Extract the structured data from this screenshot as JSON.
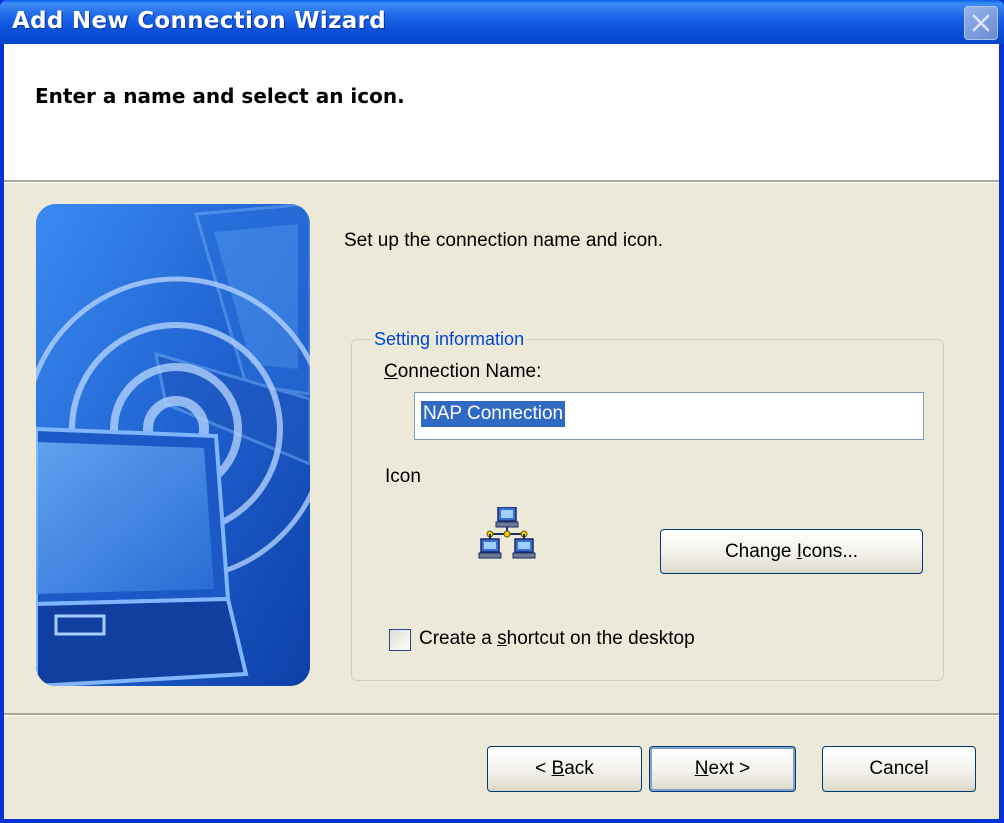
{
  "window": {
    "title": "Add New Connection Wizard"
  },
  "header": {
    "title": "Enter a name and select an icon."
  },
  "main": {
    "lead_text": "Set up the connection name and icon.",
    "group": {
      "legend": "Setting information",
      "connection_name_label_access": "C",
      "connection_name_label_rest": "onnection Name:",
      "connection_name_value": "NAP Connection",
      "icon_label": "Icon",
      "icon": "network-connection-icon",
      "change_icons_pre": "Change ",
      "change_icons_access": "I",
      "change_icons_post": "cons...",
      "shortcut_checked": false,
      "shortcut_pre": "Create a ",
      "shortcut_access": "s",
      "shortcut_post": "hortcut on the desktop"
    }
  },
  "footer": {
    "back_pre": "< ",
    "back_access": "B",
    "back_post": "ack",
    "next_access": "N",
    "next_post": "ext >",
    "cancel_label": "Cancel"
  },
  "colors": {
    "title_bar": "#0b57e0",
    "dialog_bg": "#ece9d8",
    "group_legend": "#0046d5",
    "selection": "#316ac5"
  }
}
